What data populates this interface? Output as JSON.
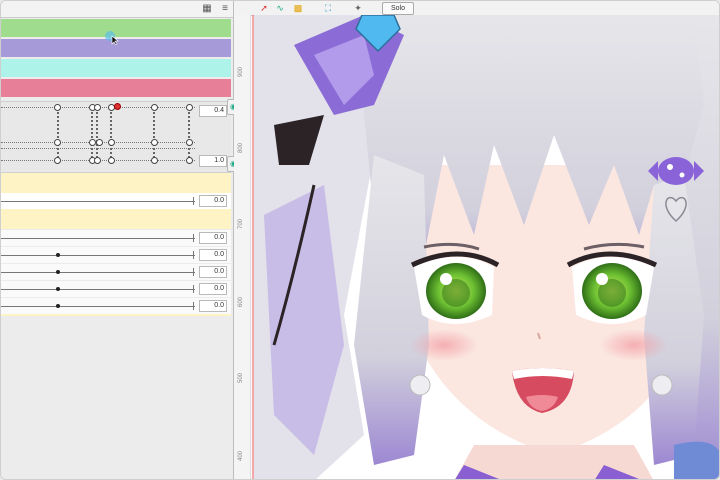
{
  "colors": {
    "band_green": "#9fdc8e",
    "band_purple": "#a79ad8",
    "band_cyan": "#aef3e9",
    "band_pink": "#e77f98",
    "yellow_band": "#fdf3c4",
    "keyframe_red": "#dd3333"
  },
  "left_panel": {
    "icons": [
      "layers-icon",
      "menu-icon"
    ],
    "keyframe_values": [
      "0.4",
      "1.0"
    ],
    "param_values": [
      "0.0",
      "0.0",
      "0.0",
      "0.0",
      "0.0",
      "0.0"
    ]
  },
  "viewport": {
    "solo_label": "Solo",
    "ruler_labels": [
      "900",
      "800",
      "700",
      "600",
      "500",
      "400"
    ],
    "tool_icons": [
      "arrow-tool-icon",
      "curve-tool-icon",
      "color-tool-icon",
      "fit-tool-icon",
      "pin-icon"
    ]
  }
}
